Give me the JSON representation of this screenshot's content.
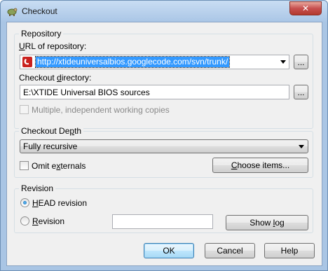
{
  "window": {
    "title": "Checkout",
    "close_label": "✕"
  },
  "repository": {
    "group_label": "Repository",
    "url_label": "URL of repository:",
    "url_value": "http://xtideuniversalbios.googlecode.com/svn/trunk/",
    "browse_url_label": "...",
    "dir_label": "Checkout directory:",
    "dir_value": "E:\\XTIDE Universal BIOS sources",
    "browse_dir_label": "...",
    "multiple_copies_label": "Multiple, independent working copies",
    "multiple_copies_checked": false
  },
  "depth": {
    "group_label": "Checkout Depth",
    "selected": "Fully recursive",
    "omit_externals_label": "Omit externals",
    "omit_externals_checked": false,
    "choose_items_label": "Choose items..."
  },
  "revision": {
    "group_label": "Revision",
    "head_label": "HEAD revision",
    "head_selected": true,
    "revision_label": "Revision",
    "revision_value": "",
    "show_log_label": "Show log"
  },
  "buttons": {
    "ok": "OK",
    "cancel": "Cancel",
    "help": "Help"
  }
}
